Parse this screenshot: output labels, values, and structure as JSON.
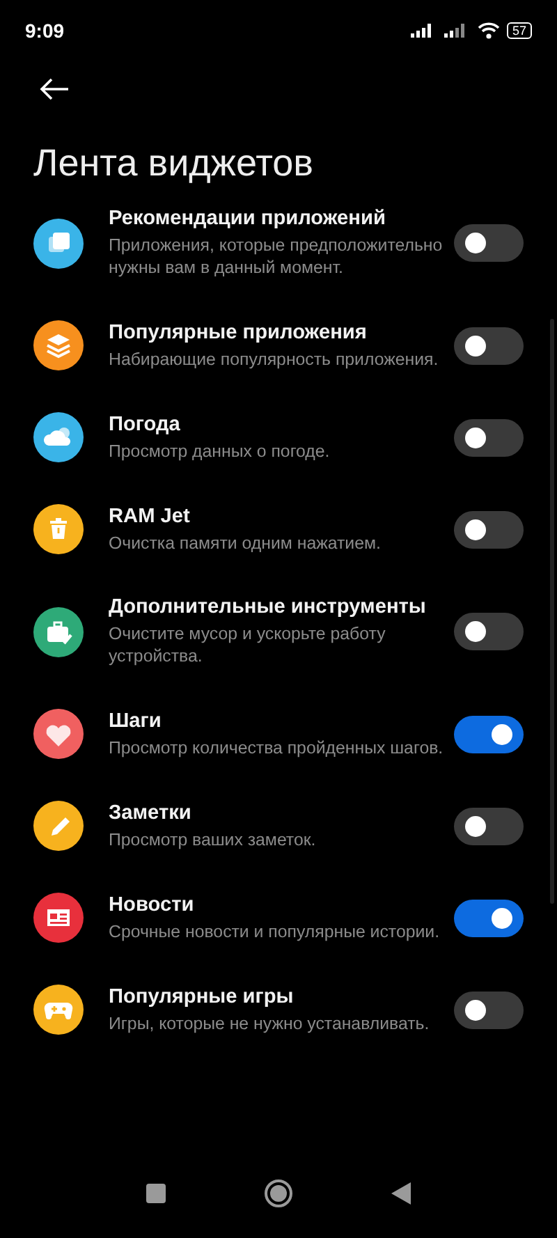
{
  "status_bar": {
    "time": "9:09",
    "battery": "57"
  },
  "header": {
    "title": "Лента виджетов"
  },
  "items": [
    {
      "kind": "cards",
      "color": "#3ab4e8",
      "title": "Рекомендации приложений",
      "description": "Приложения, которые предположительно нужны вам в данный момент.",
      "on": false
    },
    {
      "kind": "layers",
      "color": "#f7901e",
      "title": "Популярные приложения",
      "description": "Набирающие популярность приложения.",
      "on": false
    },
    {
      "kind": "cloud",
      "color": "#3ab4e8",
      "title": "Погода",
      "description": "Просмотр данных о погоде.",
      "on": false
    },
    {
      "kind": "trash",
      "color": "#f7b21e",
      "title": "RAM Jet",
      "description": "Очистка памяти одним нажатием.",
      "on": false
    },
    {
      "kind": "toolbox",
      "color": "#2eaa78",
      "title": "Дополнительные инструменты",
      "description": "Очистите мусор и ускорьте работу устройства.",
      "on": false
    },
    {
      "kind": "heart",
      "color": "#f06060",
      "title": "Шаги",
      "description": "Просмотр количества пройденных шагов.",
      "on": true
    },
    {
      "kind": "pencil",
      "color": "#f7b21e",
      "title": "Заметки",
      "description": "Просмотр ваших заметок.",
      "on": false
    },
    {
      "kind": "news",
      "color": "#e8303c",
      "title": "Новости",
      "description": "Срочные новости и популярные истории.",
      "on": true
    },
    {
      "kind": "gamepad",
      "color": "#f7b21e",
      "title": "Популярные игры",
      "description": "Игры, которые не нужно устанавливать.",
      "on": false
    }
  ]
}
